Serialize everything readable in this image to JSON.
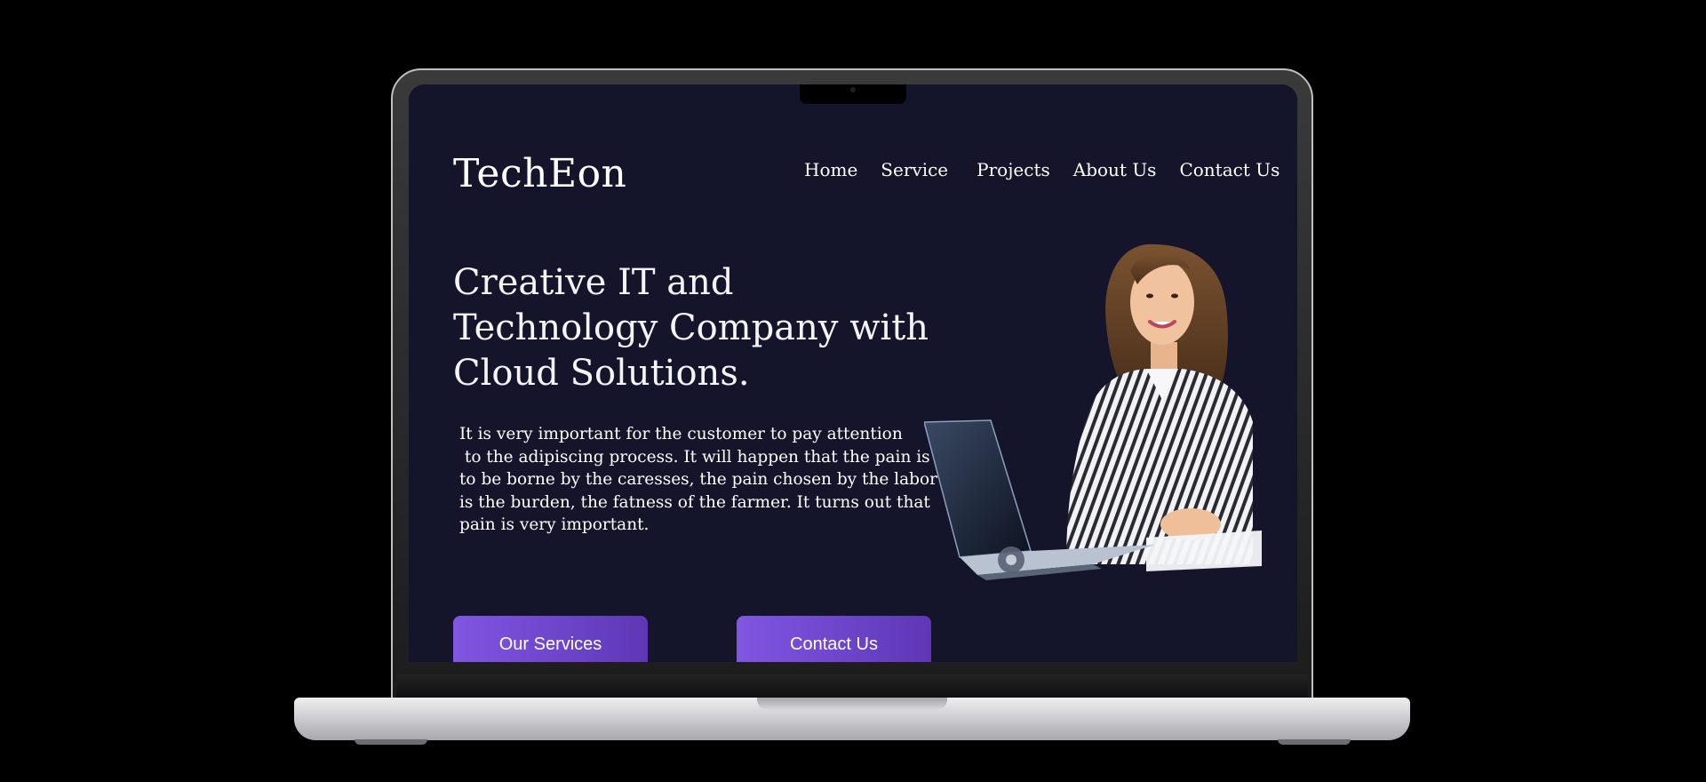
{
  "site": {
    "logo": "TechEon",
    "nav": {
      "items": [
        "Home",
        "Service",
        "Projects",
        "About Us",
        "Contact Us"
      ]
    },
    "hero": {
      "headline_lines": [
        "Creative IT and",
        "Technology Company with",
        "Cloud Solutions."
      ],
      "body_lines": [
        "It is very important for the customer to pay attention",
        " to the adipiscing process. It will happen that the pain is",
        "to be borne by the caresses, the pain chosen by the labor",
        "is the burden, the fatness of the farmer. It turns out that",
        "pain is very important."
      ],
      "buttons": {
        "primary": "Our Services",
        "secondary": "Contact Us"
      }
    }
  },
  "icons": {
    "camera": "camera-icon",
    "illustration": "woman-laptop-illustration"
  },
  "colors": {
    "background": "#000000",
    "screen_background": "#14142b",
    "text": "#ffffff",
    "button_gradient_start": "#8056e2",
    "button_gradient_end": "#5e37b6"
  }
}
